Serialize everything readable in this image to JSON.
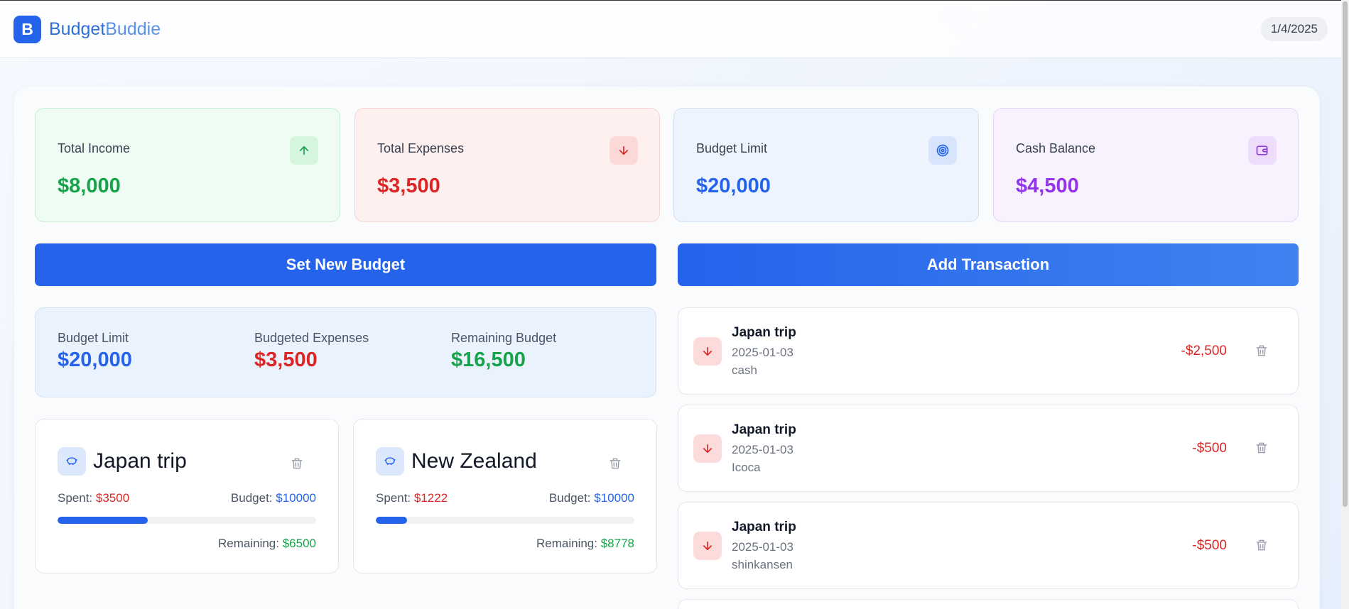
{
  "brand": {
    "logo_letter": "B",
    "name_part1": "Budget",
    "name_part2": "Buddie"
  },
  "date": "1/4/2025",
  "stats": [
    {
      "label": "Total Income",
      "value": "$8,000",
      "icon": "arrow-up-icon"
    },
    {
      "label": "Total Expenses",
      "value": "$3,500",
      "icon": "arrow-down-icon"
    },
    {
      "label": "Budget Limit",
      "value": "$20,000",
      "icon": "target-icon"
    },
    {
      "label": "Cash Balance",
      "value": "$4,500",
      "icon": "wallet-icon"
    }
  ],
  "actions": {
    "set_budget": "Set New Budget",
    "add_transaction": "Add Transaction"
  },
  "summary": {
    "limit_label": "Budget Limit",
    "limit_value": "$20,000",
    "expenses_label": "Budgeted Expenses",
    "expenses_value": "$3,500",
    "remaining_label": "Remaining Budget",
    "remaining_value": "$16,500"
  },
  "budgets": [
    {
      "name": "Japan trip",
      "spent_label": "Spent:",
      "spent": "$3500",
      "budget_label": "Budget:",
      "budget": "$10000",
      "remaining_label": "Remaining:",
      "remaining": "$6500",
      "progress": 0.35
    },
    {
      "name": "New Zealand",
      "spent_label": "Spent:",
      "spent": "$1222",
      "budget_label": "Budget:",
      "budget": "$10000",
      "remaining_label": "Remaining:",
      "remaining": "$8778",
      "progress": 0.1222
    }
  ],
  "transactions": [
    {
      "name": "Japan trip",
      "date": "2025-01-03",
      "note": "cash",
      "amount": "-$2,500"
    },
    {
      "name": "Japan trip",
      "date": "2025-01-03",
      "note": "Icoca",
      "amount": "-$500"
    },
    {
      "name": "Japan trip",
      "date": "2025-01-03",
      "note": "shinkansen",
      "amount": "-$500"
    }
  ],
  "colors": {
    "primary": "#2563eb",
    "income": "#16a34a",
    "expense": "#dc2626",
    "cash": "#9333ea"
  }
}
